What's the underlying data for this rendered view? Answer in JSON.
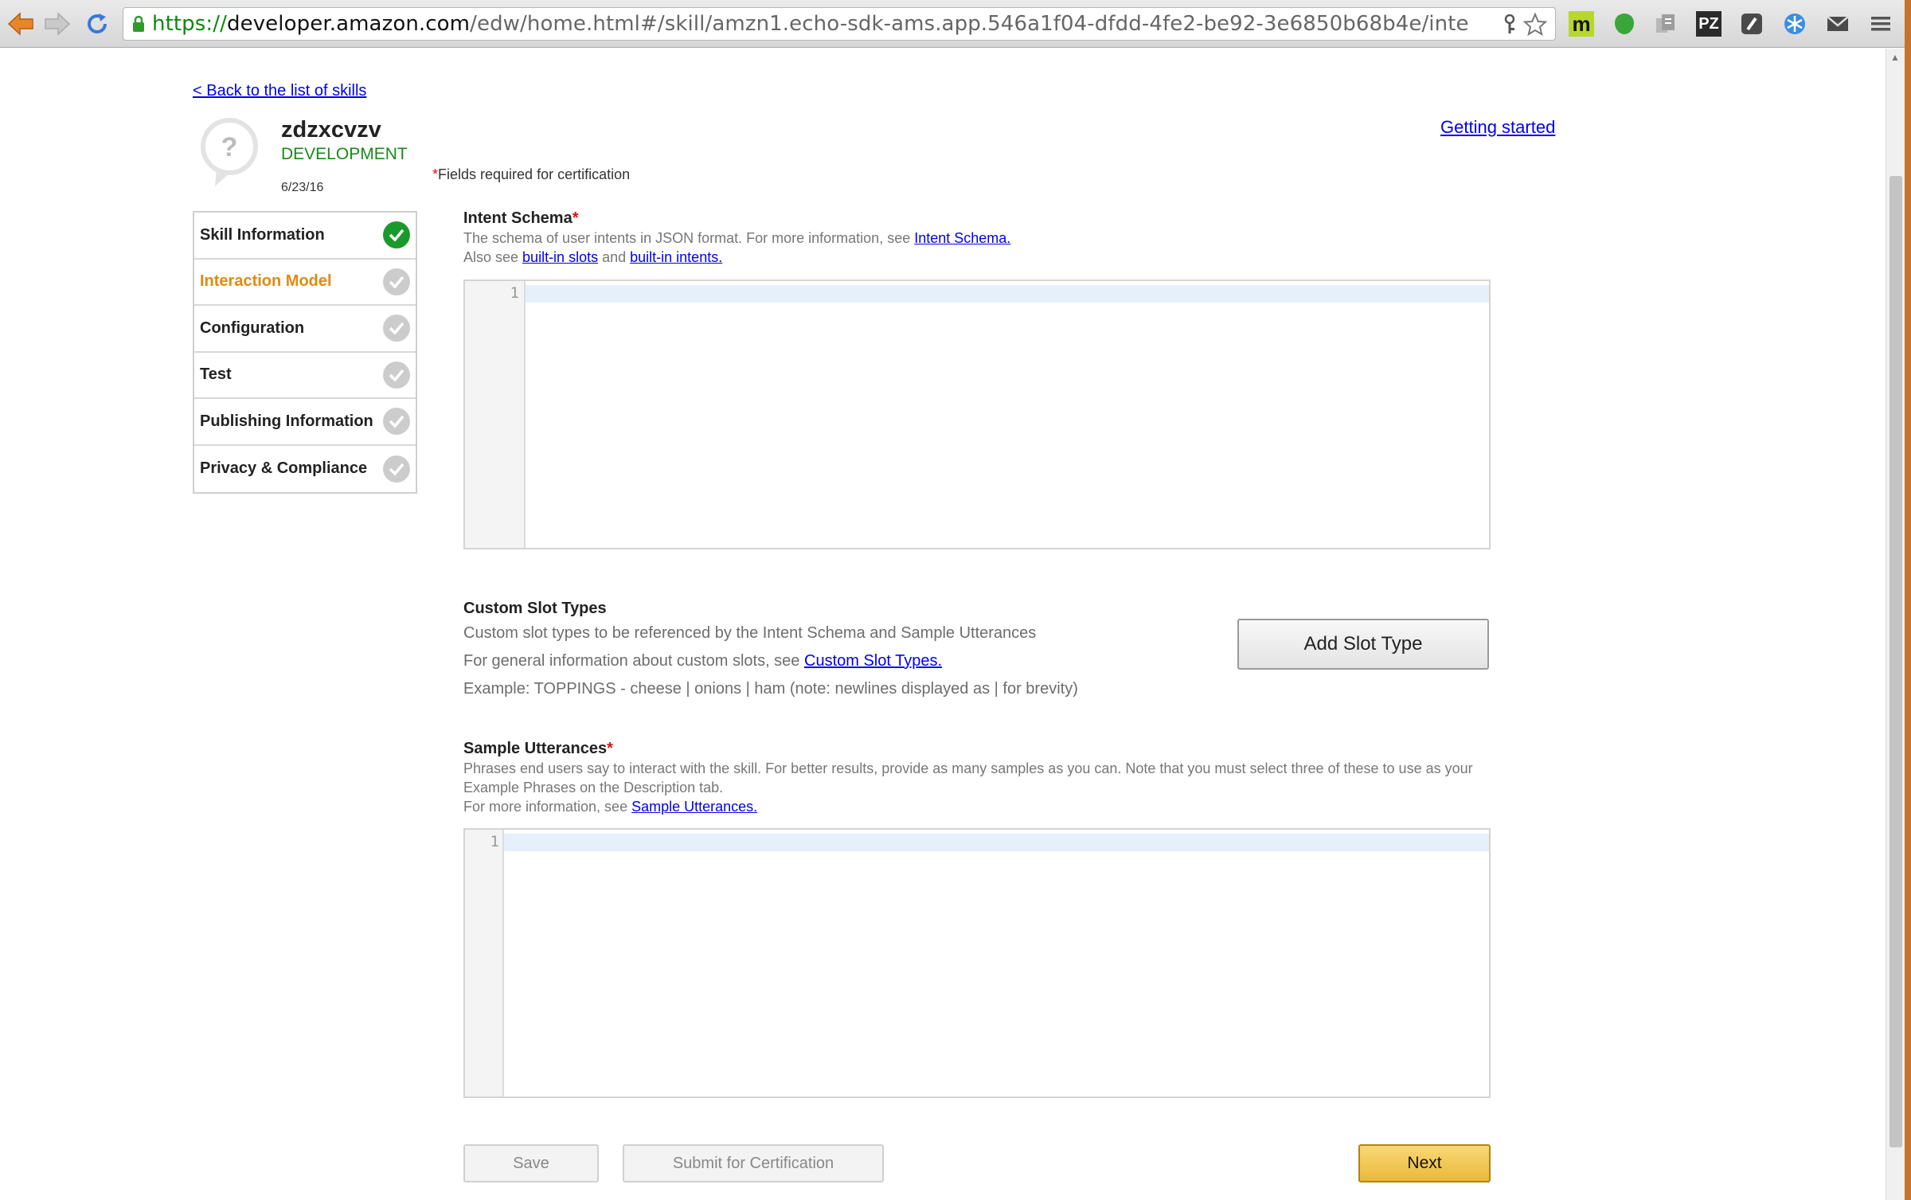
{
  "browser": {
    "url_scheme": "https://",
    "url_host": "developer.amazon.com",
    "url_path": "/edw/home.html#/skill/amzn1.echo-sdk-ams.app.546a1f04-dfdd-4fe2-be92-3e6850b68b4e/inte",
    "icons": [
      "back-arrow-icon",
      "forward-arrow-icon",
      "reload-icon",
      "lock-icon",
      "key-icon",
      "star-icon",
      "mendeley-icon",
      "shield-icon",
      "docs-icon",
      "pz-icon",
      "square-icon",
      "snowflake-icon",
      "mail-icon",
      "menu-icon"
    ],
    "ext_pz_label": "PZ",
    "ext_m_label": "m"
  },
  "page": {
    "back_link": "< Back to the list of skills",
    "getting_started": "Getting started",
    "required_note_star": "*",
    "required_note": "Fields required for certification"
  },
  "skill": {
    "avatar_glyph": "?",
    "name": "zdzxcvzv",
    "status": "DEVELOPMENT",
    "date": "6/23/16"
  },
  "sidebar": {
    "items": [
      {
        "label": "Skill Information",
        "complete": true,
        "active": false
      },
      {
        "label": "Interaction Model",
        "complete": false,
        "active": true
      },
      {
        "label": "Configuration",
        "complete": false,
        "active": false
      },
      {
        "label": "Test",
        "complete": false,
        "active": false
      },
      {
        "label": "Publishing Information",
        "complete": false,
        "active": false
      },
      {
        "label": "Privacy & Compliance",
        "complete": false,
        "active": false
      }
    ]
  },
  "intent_schema": {
    "title": "Intent Schema",
    "req": "*",
    "help_1": "The schema of user intents in JSON format. For more information, see ",
    "help_1_link": "Intent Schema.",
    "help_2_pre": "Also see ",
    "help_2_link_a": "built-in slots",
    "help_2_mid": " and ",
    "help_2_link_b": "built-in intents.",
    "line_number": "1"
  },
  "custom_slots": {
    "title": "Custom Slot Types",
    "help_1": "Custom slot types to be referenced by the Intent Schema and Sample Utterances",
    "help_2": "For general information about custom slots, see ",
    "help_2_link": "Custom Slot Types.",
    "help_3": "Example: TOPPINGS - cheese | onions | ham (note: newlines displayed as | for brevity)",
    "add_button": "Add Slot Type"
  },
  "sample_utterances": {
    "title": "Sample Utterances",
    "req": "*",
    "help_1": "Phrases end users say to interact with the skill. For better results, provide as many samples as you can. Note that you must select three of these to use as your",
    "help_2": "Example Phrases on the Description tab.",
    "help_3_pre": "For more information, see ",
    "help_3_link": "Sample Utterances.",
    "line_number": "1"
  },
  "actions": {
    "save": "Save",
    "submit": "Submit for Certification",
    "next": "Next"
  },
  "colors": {
    "active_tab": "#e08a12",
    "complete": "#1a9a2a",
    "status": "#198a19",
    "next_button": "#eab93a"
  }
}
